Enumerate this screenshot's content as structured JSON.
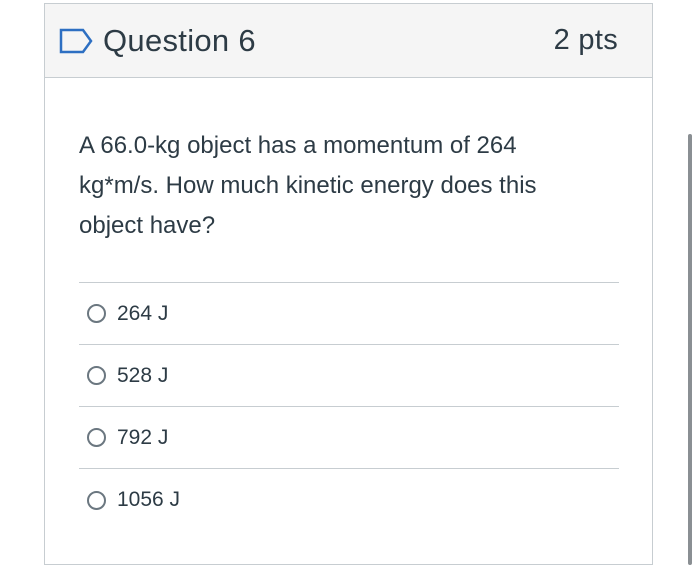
{
  "question": {
    "title": "Question 6",
    "points": "2 pts",
    "text": "A 66.0-kg object has a momentum of 264 kg*m/s. How much kinetic energy does this object have?",
    "flag_icon": "bookmark-flag-icon",
    "accent_color": "#2d6fc2",
    "answers": [
      {
        "label": "264 J"
      },
      {
        "label": "528 J"
      },
      {
        "label": "792 J"
      },
      {
        "label": "1056 J"
      }
    ]
  }
}
